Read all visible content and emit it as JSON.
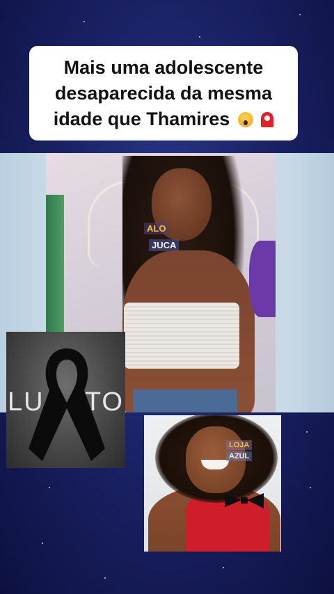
{
  "caption": {
    "line1": "Mais uma adolescente",
    "line2": "desaparecida da mesma",
    "line3": "idade que Thamires",
    "emojis": [
      "face-screaming-icon",
      "police-light-icon"
    ]
  },
  "photo_main": {
    "watermark_top": "ALO",
    "watermark_bottom": "JUCA"
  },
  "luto": {
    "left_text": "LU",
    "right_text": "TO",
    "icon": "black-ribbon-icon"
  },
  "photo_second": {
    "watermark_top": "LOJA",
    "watermark_bottom": "AZUL"
  },
  "colors": {
    "background": "#1b2266",
    "caption_bg": "#ffffff",
    "caption_text": "#111111",
    "luto_bg": "#474747"
  }
}
